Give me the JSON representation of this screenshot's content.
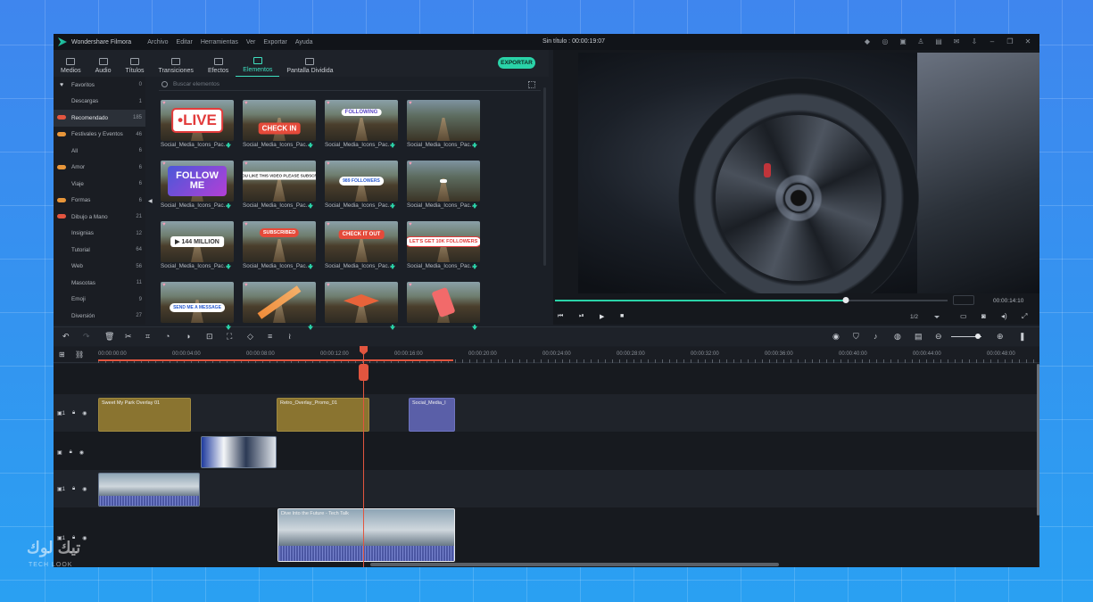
{
  "titlebar": {
    "app_name": "Wondershare Filmora",
    "menu": [
      "Archivo",
      "Editar",
      "Herramientas",
      "Ver",
      "Exportar",
      "Ayuda"
    ],
    "project_title": "Sin título : 00:00:19:07"
  },
  "tabs": [
    {
      "label": "Medios"
    },
    {
      "label": "Audio"
    },
    {
      "label": "Títulos"
    },
    {
      "label": "Transiciones"
    },
    {
      "label": "Efectos"
    },
    {
      "label": "Elementos"
    },
    {
      "label": "Pantalla Dividida"
    }
  ],
  "export_label": "EXPORTAR",
  "search_placeholder": "Buscar elementos",
  "sidebar": [
    {
      "label": "Favoritos",
      "count": "0"
    },
    {
      "label": "Descargas",
      "count": "1"
    },
    {
      "label": "Recomendado",
      "count": "185"
    },
    {
      "label": "Festivales y Eventos",
      "count": "46"
    },
    {
      "label": "All",
      "count": "6"
    },
    {
      "label": "Amor",
      "count": "6"
    },
    {
      "label": "Viaje",
      "count": "6"
    },
    {
      "label": "Formas",
      "count": "6"
    },
    {
      "label": "Dibujo a Mano",
      "count": "21"
    },
    {
      "label": "Insignias",
      "count": "12"
    },
    {
      "label": "Tutorial",
      "count": "64"
    },
    {
      "label": "Web",
      "count": "56"
    },
    {
      "label": "Mascotas",
      "count": "11"
    },
    {
      "label": "Emoji",
      "count": "9"
    },
    {
      "label": "Diversión",
      "count": "27"
    }
  ],
  "grid": {
    "caption": "Social_Media_Icons_Pac...",
    "badges": [
      "•LIVE",
      "CHECK IN",
      "FOLLOWING",
      "",
      "FOLLOW ME",
      "IF YOU LIKE THIS VIDEO PLEASE SUBSCRIBE",
      "989 FOLLOWERS",
      "",
      "▶ 144 MILLION",
      "SUBSCRIBED",
      "CHECK IT OUT",
      "LET'S GET 10K FOLLOWERS",
      "SEND ME A MESSAGE",
      "",
      "",
      ""
    ]
  },
  "preview": {
    "duration": "00:00:14:10",
    "fraction": "1/2",
    "progress": 0.74
  },
  "timeline": {
    "ticks": [
      "00:00:00:00",
      "00:00:04:00",
      "00:00:08:00",
      "00:00:12:00",
      "00:00:16:00",
      "00:00:20:00",
      "00:00:24:00",
      "00:00:28:00",
      "00:00:32:00",
      "00:00:36:00",
      "00:00:40:00",
      "00:00:44:00",
      "00:00:48:00"
    ],
    "clips": {
      "gold1": "Sweet My Park Overlay 01",
      "gold2": "Retro_Overlay_Promo_01",
      "blue": "Social_Media_I",
      "video": "Dive Into the Future - Tech Talk"
    }
  },
  "watermark": {
    "text": "تيك لوك",
    "sub": "TECH LOOK"
  }
}
